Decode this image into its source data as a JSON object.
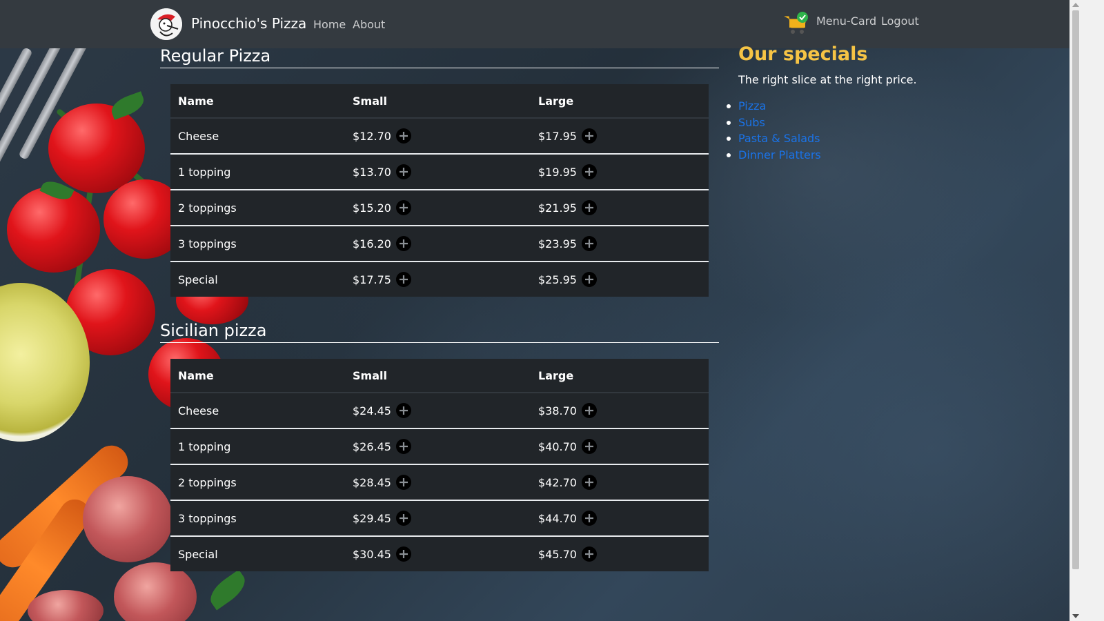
{
  "navbar": {
    "brand": "Pinocchio's Pizza",
    "links": [
      "Home",
      "About"
    ],
    "right_links": [
      "Menu-Card",
      "Logout"
    ],
    "cart_icon": "shopping-cart-check-icon"
  },
  "sections": [
    {
      "title": "Regular Pizza",
      "headers": [
        "Name",
        "Small",
        "Large"
      ],
      "rows": [
        {
          "name": "Cheese",
          "small": "$12.70",
          "large": "$17.95"
        },
        {
          "name": "1 topping",
          "small": "$13.70",
          "large": "$19.95"
        },
        {
          "name": "2 toppings",
          "small": "$15.20",
          "large": "$21.95"
        },
        {
          "name": "3 toppings",
          "small": "$16.20",
          "large": "$23.95"
        },
        {
          "name": "Special",
          "small": "$17.75",
          "large": "$25.95"
        }
      ]
    },
    {
      "title": "Sicilian pizza",
      "headers": [
        "Name",
        "Small",
        "Large"
      ],
      "rows": [
        {
          "name": "Cheese",
          "small": "$24.45",
          "large": "$38.70"
        },
        {
          "name": "1 topping",
          "small": "$26.45",
          "large": "$40.70"
        },
        {
          "name": "2 toppings",
          "small": "$28.45",
          "large": "$42.70"
        },
        {
          "name": "3 toppings",
          "small": "$29.45",
          "large": "$44.70"
        },
        {
          "name": "Special",
          "small": "$30.45",
          "large": "$45.70"
        }
      ]
    }
  ],
  "sidebar": {
    "title": "Our specials",
    "subtitle": "The right slice at the right price.",
    "links": [
      "Pizza",
      "Subs",
      "Pasta & Salads",
      "Dinner Platters"
    ]
  },
  "colors": {
    "navbar": "#343a40",
    "table": "#212529",
    "accent": "#f6c445",
    "link": "#1a73e8"
  }
}
